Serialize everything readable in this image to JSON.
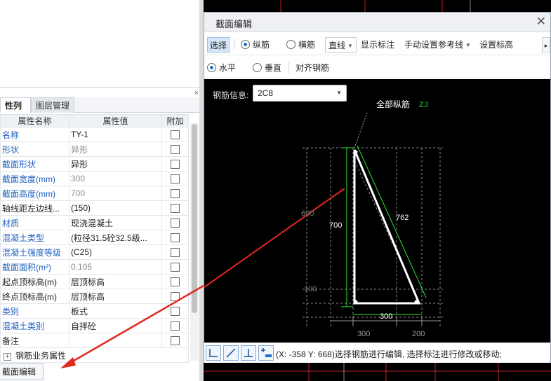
{
  "dialog": {
    "title": "截面编辑",
    "close": "✕",
    "toolbar1": {
      "select": "选择",
      "longitudinal": "纵筋",
      "transverse": "横筋",
      "line": "直线",
      "show_dimension": "显示标注",
      "manual_ref_line": "手动设置参考线",
      "set_elevation": "设置标高",
      "more": "▸"
    },
    "toolbar2": {
      "horizontal": "水平",
      "vertical": "垂直",
      "align_rebar": "对齐钢筋"
    },
    "canvas": {
      "rebar_info_label": "钢筋信息:",
      "rebar_info_value": "2C8",
      "all_long_rebar": "全部纵筋",
      "zj": "ZJ",
      "dim_700": "700",
      "dim_762": "762",
      "dim_300_inner": "300",
      "dim_300_bottom": "300",
      "dim_200": "200",
      "dim_600": "600",
      "dim_100": "100"
    },
    "status": "(X: -358 Y: 668)选择钢筋进行编辑, 选择标注进行修改或移动;"
  },
  "property_panel": {
    "tabs": [
      "性列表",
      "图层管理"
    ],
    "headers": [
      "属性名称",
      "属性值",
      "附加"
    ],
    "rows": [
      {
        "name": "名称",
        "value": "TY-1"
      },
      {
        "name": "形状",
        "value": "异形"
      },
      {
        "name": "截面形状",
        "value": "异形"
      },
      {
        "name": "截面宽度(mm)",
        "value": "300"
      },
      {
        "name": "截面高度(mm)",
        "value": "700"
      },
      {
        "name": "轴线距左边线...",
        "value": "(150)"
      },
      {
        "name": "材质",
        "value": "现浇混凝土"
      },
      {
        "name": "混凝土类型",
        "value": "(粒径31.5砼32.5级..."
      },
      {
        "name": "混凝土强度等级",
        "value": "(C25)"
      },
      {
        "name": "截面面积(m²)",
        "value": "0.105"
      },
      {
        "name": "起点顶标高(m)",
        "value": "层顶标高"
      },
      {
        "name": "终点顶标高(m)",
        "value": "层顶标高"
      },
      {
        "name": "类别",
        "value": "板式"
      },
      {
        "name": "混凝土类别",
        "value": "自拌砼"
      },
      {
        "name": "备注",
        "value": ""
      }
    ],
    "group_label": "钢筋业务属性",
    "close": "×"
  },
  "bottom_button": "截面编辑",
  "colors": {
    "accent": "#1f6fd0",
    "annotation_arrow": "#e0281e",
    "rebar_green": "#2fe52f",
    "cad_background": "#000000"
  }
}
